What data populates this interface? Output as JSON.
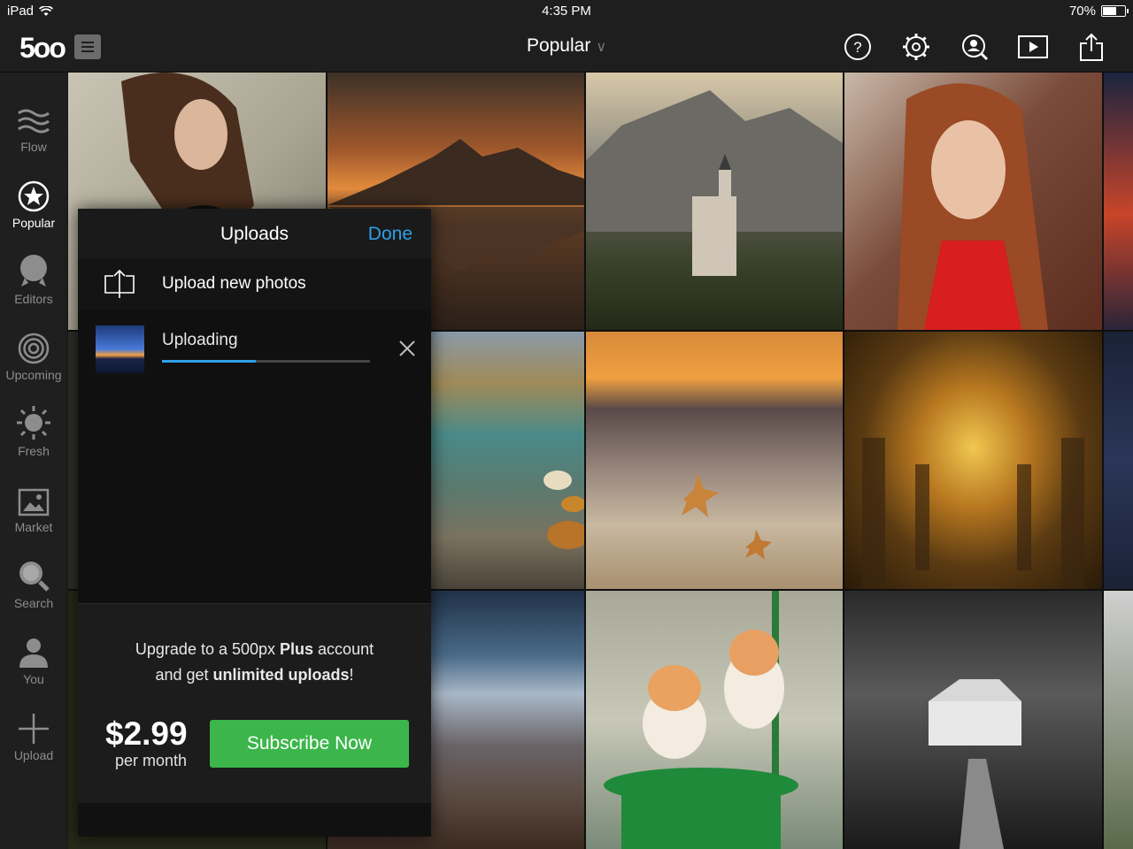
{
  "status": {
    "device": "iPad",
    "time": "4:35 PM",
    "battery": "70%",
    "battery_level": 0.7
  },
  "nav": {
    "logo": "5oo",
    "title": "Popular",
    "icons": [
      "help-icon",
      "settings-icon",
      "profile-search-icon",
      "slideshow-icon",
      "share-icon"
    ]
  },
  "sidebar": {
    "items": [
      {
        "label": "Flow",
        "icon": "flow-icon"
      },
      {
        "label": "Popular",
        "icon": "star-icon",
        "active": true
      },
      {
        "label": "Editors",
        "icon": "editors-icon"
      },
      {
        "label": "Upcoming",
        "icon": "upcoming-icon"
      },
      {
        "label": "Fresh",
        "icon": "sun-icon"
      },
      {
        "label": "Market",
        "icon": "market-icon"
      },
      {
        "label": "Search",
        "icon": "search-icon"
      },
      {
        "label": "You",
        "icon": "user-icon"
      },
      {
        "label": "Upload",
        "icon": "plus-icon"
      }
    ]
  },
  "panel": {
    "title": "Uploads",
    "done": "Done",
    "upload_new": "Upload new photos",
    "uploading": "Uploading",
    "progress": 0.45,
    "upsell_line1_pre": "Upgrade to a 500px ",
    "upsell_line1_bold": "Plus",
    "upsell_line1_post": " account",
    "upsell_line2_pre": "and get ",
    "upsell_line2_bold": "unlimited uploads",
    "upsell_line2_post": "!",
    "price": "$2.99",
    "per": "per month",
    "subscribe": "Subscribe Now"
  },
  "colors": {
    "accent": "#2f9fe8",
    "subscribe": "#3cb64b"
  }
}
